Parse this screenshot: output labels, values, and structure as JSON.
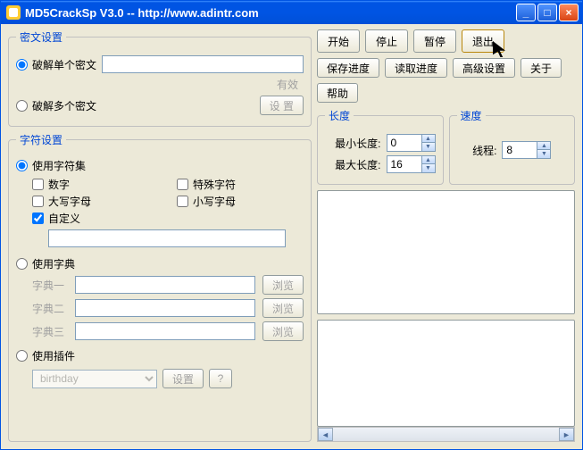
{
  "titlebar": {
    "title": "MD5CrackSp V3.0 -- http://www.adintr.com"
  },
  "win_btns": {
    "min": "_",
    "max": "□",
    "close": "×"
  },
  "cipher": {
    "legend": "密文设置",
    "single_radio": "破解单个密文",
    "single_value": "",
    "valid_hint": "有效",
    "multi_radio": "破解多个密文",
    "multi_btn": "设 置"
  },
  "charset": {
    "legend": "字符设置",
    "use_charset_radio": "使用字符集",
    "digits": "数字",
    "special": "特殊字符",
    "upper": "大写字母",
    "lower": "小写字母",
    "custom": "自定义",
    "custom_value": "",
    "use_dict_radio": "使用字典",
    "dict1": "字典一",
    "dict2": "字典二",
    "dict3": "字典三",
    "dict1_val": "",
    "dict2_val": "",
    "dict3_val": "",
    "browse": "浏览",
    "use_plugin_radio": "使用插件",
    "plugin_selected": "birthday",
    "plugin_set": "设置",
    "plugin_help": "?"
  },
  "actions": {
    "start": "开始",
    "stop": "停止",
    "pause": "暂停",
    "exit": "退出",
    "save": "保存进度",
    "load": "读取进度",
    "advanced": "高级设置",
    "about": "关于",
    "help": "帮助"
  },
  "length_box": {
    "legend": "长度",
    "min_label": "最小长度:",
    "min_val": "0",
    "max_label": "最大长度:",
    "max_val": "16"
  },
  "speed_box": {
    "legend": "速度",
    "threads_label": "线程:",
    "threads_val": "8"
  },
  "scroll": {
    "left": "◄",
    "right": "►"
  }
}
